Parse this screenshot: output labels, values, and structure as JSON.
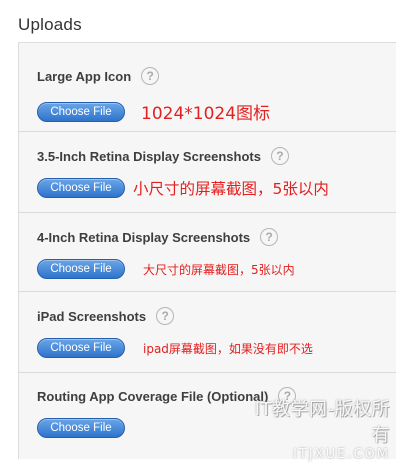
{
  "page": {
    "title": "Uploads"
  },
  "sections": [
    {
      "label": "Large App Icon",
      "button": "Choose File",
      "annotation": "1024*1024图标"
    },
    {
      "label": "3.5-Inch Retina Display Screenshots",
      "button": "Choose File",
      "annotation": "小尺寸的屏幕截图，5张以内"
    },
    {
      "label": "4-Inch Retina Display Screenshots",
      "button": "Choose File",
      "annotation": "大尺寸的屏幕截图，5张以内"
    },
    {
      "label": "iPad Screenshots",
      "button": "Choose File",
      "annotation": "ipad屏幕截图，如果没有即不选"
    },
    {
      "label": "Routing App Coverage File (Optional)",
      "button": "Choose File",
      "annotation": ""
    }
  ],
  "icons": {
    "help": "?"
  },
  "watermark": {
    "line1": "IT教学网-版权所有",
    "line2": "ITJXUE.COM"
  },
  "colors": {
    "annotation": "#e41f1f",
    "button": "#3a7fd5",
    "panel_bg": "#f6f6f6"
  }
}
